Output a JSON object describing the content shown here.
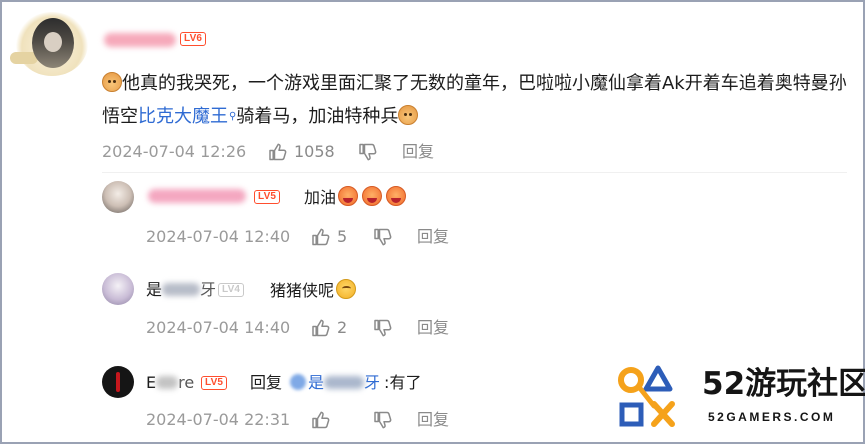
{
  "comment": {
    "level_badge": "LV6",
    "text_part1": "他真的我哭死，一个游戏里面汇聚了无数的童年，巴啦啦小魔仙拿着Ak开着车追着奥特曼孙悟空",
    "link_text": "比克大魔王",
    "text_part2": "骑着马，加油特种兵",
    "timestamp": "2024-07-04 12:26",
    "like_count": "1058",
    "reply_label": "回复",
    "emoji_icon": "doge-emoji"
  },
  "replies": [
    {
      "level_badge": "LV5",
      "text": "加油",
      "emoji_icon": "cheer-emoji",
      "timestamp": "2024-07-04 12:40",
      "like_count": "5",
      "reply_label": "回复"
    },
    {
      "name_visible": "是",
      "name_tail": "牙",
      "level_badge": "LV4",
      "text": "猪猪侠呢",
      "emoji_icon": "sigh-emoji",
      "timestamp": "2024-07-04 14:40",
      "like_count": "2",
      "reply_label": "回复"
    },
    {
      "name_visible": "E",
      "name_tail": "re",
      "level_badge": "LV5",
      "reply_prefix": "回复",
      "mention_visible": "是",
      "mention_tail": "牙",
      "text": ":有了",
      "timestamp": "2024-07-04 22:31",
      "like_count": "",
      "reply_label": "回复"
    }
  ],
  "watermark": {
    "title": "52游玩社区",
    "subtitle": "52GAMERS.COM",
    "colors": {
      "orange": "#f5a21b",
      "blue": "#2d5db8"
    }
  },
  "colors": {
    "level_badge": "#ff4e2e",
    "link": "#2f6bd3",
    "meta_text": "#9a9a9a"
  }
}
